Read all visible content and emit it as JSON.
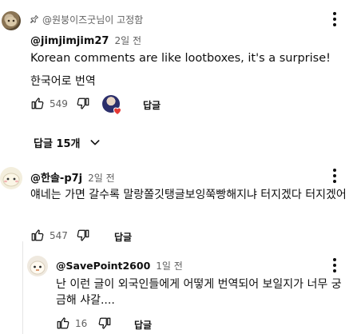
{
  "comments": [
    {
      "pinned_label": "@원붕이즈굿님이 고정함",
      "author": "@jimjimjim27",
      "time": "2일 전",
      "text": "Korean comments are like lootboxes, it's a surprise!",
      "translate_label": "한국어로 번역",
      "likes": "549",
      "reply_label": "답글",
      "replies_toggle": "답글 15개"
    },
    {
      "author": "@한솔-p7j",
      "time": "2일 전",
      "text": "얘네는 가면 갈수록 말랑쫄깃탱글보잉쭉빵해지냐 터지겠다 터지겠어ㅋㅋ",
      "likes": "547",
      "reply_label": "답글"
    }
  ],
  "reply": {
    "author": "@SavePoint2600",
    "time": "1일 전",
    "text": "난 이런 글이 외국인들에게 어떻게 번역되어 보일지가 너무 궁금해 샤갈....",
    "likes": "16",
    "reply_label": "답글"
  },
  "icons": [
    "pin-icon",
    "like-icon",
    "dislike-icon",
    "more-vert-icon",
    "chevron-down-icon",
    "heart-icon"
  ],
  "colors": {
    "text": "#0f0f0f",
    "secondary": "#606060",
    "heart": "#e53935"
  }
}
